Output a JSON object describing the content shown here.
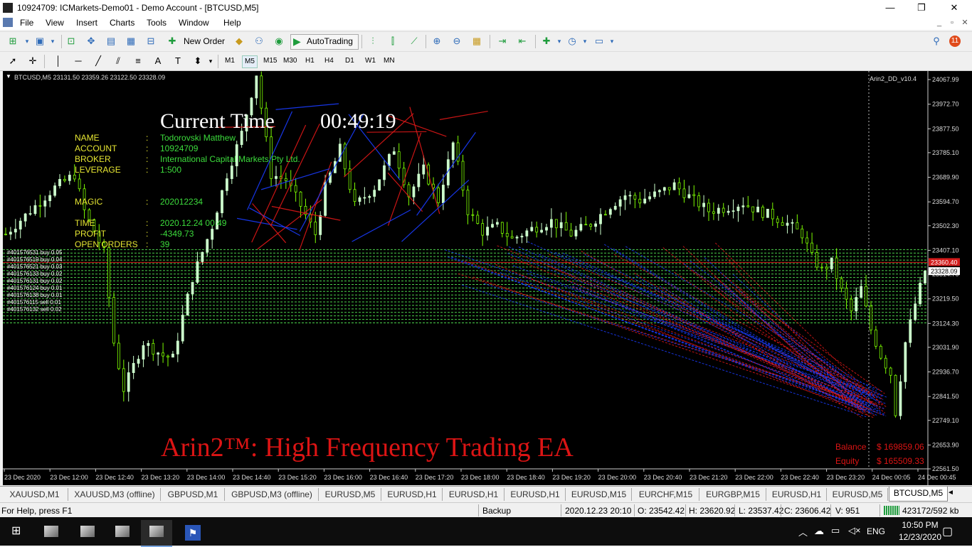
{
  "window": {
    "title": "10924709: ICMarkets-Demo01 - Demo Account - [BTCUSD,M5]",
    "controls": [
      "—",
      "❐",
      "✕"
    ]
  },
  "menu": {
    "items": [
      "File",
      "View",
      "Insert",
      "Charts",
      "Tools",
      "Window",
      "Help"
    ],
    "mdi_controls": [
      "_",
      "▫",
      "✕"
    ],
    "notification_count": "11"
  },
  "toolbar": {
    "new_order": "New Order",
    "autotrading": "AutoTrading",
    "timeframes": [
      "M1",
      "M5",
      "M15",
      "M30",
      "H1",
      "H4",
      "D1",
      "W1",
      "MN"
    ],
    "active_timeframe": "M5"
  },
  "chart": {
    "header": "BTCUSD,M5  23131.50 23359.26 23122.50 23328.09",
    "indicator_name": "Arin2_DD_v10.4",
    "current_time_label": "Current Time",
    "current_time_value": "00:49:19",
    "info_rows": [
      {
        "label": "NAME",
        "sep": ":",
        "value": "Todorovski Matthew"
      },
      {
        "label": "ACCOUNT",
        "sep": ":",
        "value": "10924709"
      },
      {
        "label": "BROKER",
        "sep": ":",
        "value": "International Capital Markets Pty Ltd."
      },
      {
        "label": "LEVERAGE",
        "sep": ":",
        "value": "1:500"
      },
      {
        "label": "MAGIC",
        "sep": ":",
        "value": "202012234"
      },
      {
        "label": "TIME",
        "sep": ":",
        "value": "2020.12.24 00:49"
      },
      {
        "label": "PROFIT",
        "sep": ":",
        "value": "-4349.73"
      },
      {
        "label": "OPEN ORDERS",
        "sep": ":",
        "value": "39"
      }
    ],
    "banner": "Arin2™: High Frequency Trading EA",
    "balance_label": "Balance",
    "balance_value": "$ 169859.06",
    "equity_label": "Equity",
    "equity_value": "$ 165509.33",
    "order_labels": [
      "#401576531 buy 0.05",
      "#401576519 buy 0.04",
      "#401576521 buy 0.03",
      "#401576133 buy 0.02",
      "#401576131 buy 0.02",
      "#401576124 buy 0.01",
      "#401576138 buy 0.01",
      "#401576115 sell 0.01",
      "#401576132 sell 0.02"
    ],
    "current_price_tag": "23360.40",
    "last_price_tag": "23328.09",
    "colors": {
      "background": "#000000",
      "bull": "#ccffcc",
      "bear": "#7cfc00",
      "info_label": "#e6e632",
      "info_value": "#3cdc3c",
      "banner": "#dc1414",
      "buy_line": "#1a3cff",
      "sell_line": "#e01818",
      "order_level": "#4cd44c"
    }
  },
  "chart_data": {
    "type": "candlestick",
    "symbol": "BTCUSD",
    "timeframe": "M5",
    "ohlc_header": {
      "open": 23131.5,
      "high": 23359.26,
      "low": 23122.5,
      "close": 23328.09
    },
    "y_ticks": [
      24067.99,
      23972.7,
      23877.5,
      23785.1,
      23689.9,
      23594.7,
      23502.3,
      23407.1,
      23314.7,
      23219.5,
      23124.3,
      23031.9,
      22936.7,
      22841.5,
      22749.1,
      22653.9,
      22561.5
    ],
    "x_ticks": [
      "23 Dec 2020",
      "23 Dec 12:00",
      "23 Dec 12:40",
      "23 Dec 13:20",
      "23 Dec 14:00",
      "23 Dec 14:40",
      "23 Dec 15:20",
      "23 Dec 16:00",
      "23 Dec 16:40",
      "23 Dec 17:20",
      "23 Dec 18:00",
      "23 Dec 18:40",
      "23 Dec 19:20",
      "23 Dec 20:00",
      "23 Dec 20:40",
      "23 Dec 21:20",
      "23 Dec 22:00",
      "23 Dec 22:40",
      "23 Dec 23:20",
      "24 Dec 00:05",
      "24 Dec 00:45"
    ],
    "price_path": [
      [
        0,
        23470
      ],
      [
        10,
        23560
      ],
      [
        20,
        23650
      ],
      [
        28,
        23700
      ],
      [
        32,
        23560
      ],
      [
        40,
        23400
      ],
      [
        44,
        23050
      ],
      [
        48,
        22870
      ],
      [
        56,
        23050
      ],
      [
        64,
        23000
      ],
      [
        68,
        22990
      ],
      [
        72,
        23150
      ],
      [
        76,
        23300
      ],
      [
        84,
        23500
      ],
      [
        90,
        23700
      ],
      [
        96,
        23860
      ],
      [
        102,
        24090
      ],
      [
        108,
        23700
      ],
      [
        114,
        23680
      ],
      [
        120,
        23580
      ],
      [
        126,
        23470
      ],
      [
        130,
        23650
      ],
      [
        136,
        23800
      ],
      [
        142,
        23580
      ],
      [
        150,
        23650
      ],
      [
        158,
        23800
      ],
      [
        164,
        23620
      ],
      [
        170,
        23720
      ],
      [
        176,
        23600
      ],
      [
        182,
        23820
      ],
      [
        188,
        23560
      ],
      [
        194,
        23480
      ],
      [
        200,
        23500
      ],
      [
        206,
        23450
      ],
      [
        214,
        23490
      ],
      [
        222,
        23520
      ],
      [
        230,
        23470
      ],
      [
        238,
        23510
      ],
      [
        246,
        23580
      ],
      [
        252,
        23620
      ],
      [
        258,
        23600
      ],
      [
        266,
        23630
      ],
      [
        272,
        23660
      ],
      [
        280,
        23600
      ],
      [
        286,
        23560
      ],
      [
        292,
        23570
      ],
      [
        300,
        23590
      ],
      [
        306,
        23560
      ],
      [
        312,
        23540
      ],
      [
        318,
        23510
      ],
      [
        324,
        23470
      ],
      [
        328,
        23380
      ],
      [
        332,
        23330
      ],
      [
        336,
        23360
      ],
      [
        340,
        23250
      ],
      [
        344,
        23170
      ],
      [
        348,
        23260
      ],
      [
        352,
        23100
      ],
      [
        356,
        23000
      ],
      [
        360,
        22930
      ],
      [
        362,
        22780
      ],
      [
        366,
        23050
      ],
      [
        370,
        23200
      ],
      [
        374,
        23328
      ]
    ],
    "series": [
      {
        "name": "buy orders",
        "color": "#1a3cff"
      },
      {
        "name": "sell orders",
        "color": "#e01818"
      }
    ]
  },
  "tabs": [
    "XAUUSD,M1",
    "XAUUSD,M3 (offline)",
    "GBPUSD,M1",
    "GBPUSD,M3 (offline)",
    "EURUSD,M5",
    "EURUSD,H1",
    "EURUSD,H1",
    "EURUSD,H1",
    "EURUSD,M15",
    "EURCHF,M15",
    "EURGBP,M15",
    "EURUSD,H1",
    "EURUSD,M5",
    "BTCUSD,M5"
  ],
  "tab_nav": "◄",
  "status": {
    "help": "For Help, press F1",
    "profile": "Backup",
    "datetime": "2020.12.23 20:10",
    "open": "O: 23542.42",
    "high": "H: 23620.92",
    "low": "L: 23537.42",
    "close": "C: 23606.42",
    "volume": "V: 951",
    "traffic": "423172/592 kb"
  },
  "taskbar": {
    "lang": "ENG",
    "time": "10:50 PM",
    "date": "12/23/2020"
  }
}
